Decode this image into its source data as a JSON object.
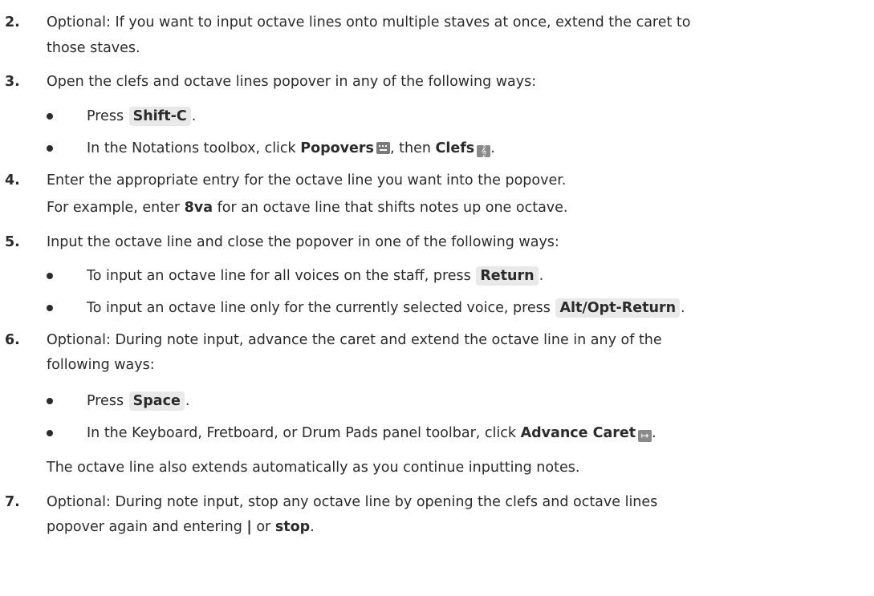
{
  "steps": [
    {
      "number": "2.",
      "line1": "Optional: If you want to input octave lines onto multiple staves at once, extend the caret to",
      "line2": "those staves."
    },
    {
      "number": "3.",
      "text": "Open the clefs and octave lines popover in any of the following ways:",
      "bullets": [
        {
          "pre": "Press ",
          "key": "Shift-C",
          "post": "."
        },
        {
          "pre": "In the Notations toolbox, click ",
          "bold1": "Popovers",
          "icon1": "keyboard-icon",
          "mid": ", then ",
          "bold2": "Clefs",
          "icon2": "treble-clef-icon",
          "post": "."
        }
      ]
    },
    {
      "number": "4.",
      "text": "Enter the appropriate entry for the octave line you want into the popover.",
      "example_pre": "For example, enter ",
      "example_bold": "8va",
      "example_post": " for an octave line that shifts notes up one octave."
    },
    {
      "number": "5.",
      "text": "Input the octave line and close the popover in one of the following ways:",
      "bullets": [
        {
          "pre": "To input an octave line for all voices on the staff, press ",
          "key": "Return",
          "post": "."
        },
        {
          "pre": "To input an octave line only for the currently selected voice, press ",
          "key": "Alt/Opt-Return",
          "post": "."
        }
      ]
    },
    {
      "number": "6.",
      "line1": "Optional: During note input, advance the caret and extend the octave line in any of the",
      "line2": "following ways:",
      "bullets": [
        {
          "pre": "Press ",
          "key": "Space",
          "post": "."
        },
        {
          "pre": "In the Keyboard, Fretboard, or Drum Pads panel toolbar, click ",
          "bold1": "Advance Caret",
          "icon1": "advance-caret-icon",
          "post": "."
        }
      ],
      "note": "The octave line also extends automatically as you continue inputting notes."
    },
    {
      "number": "7.",
      "line1": "Optional: During note input, stop any octave line by opening the clefs and octave lines",
      "line2_pre": "popover again and entering ",
      "line2_bold1": "|",
      "line2_mid": " or ",
      "line2_bold2": "stop",
      "line2_post": "."
    }
  ]
}
